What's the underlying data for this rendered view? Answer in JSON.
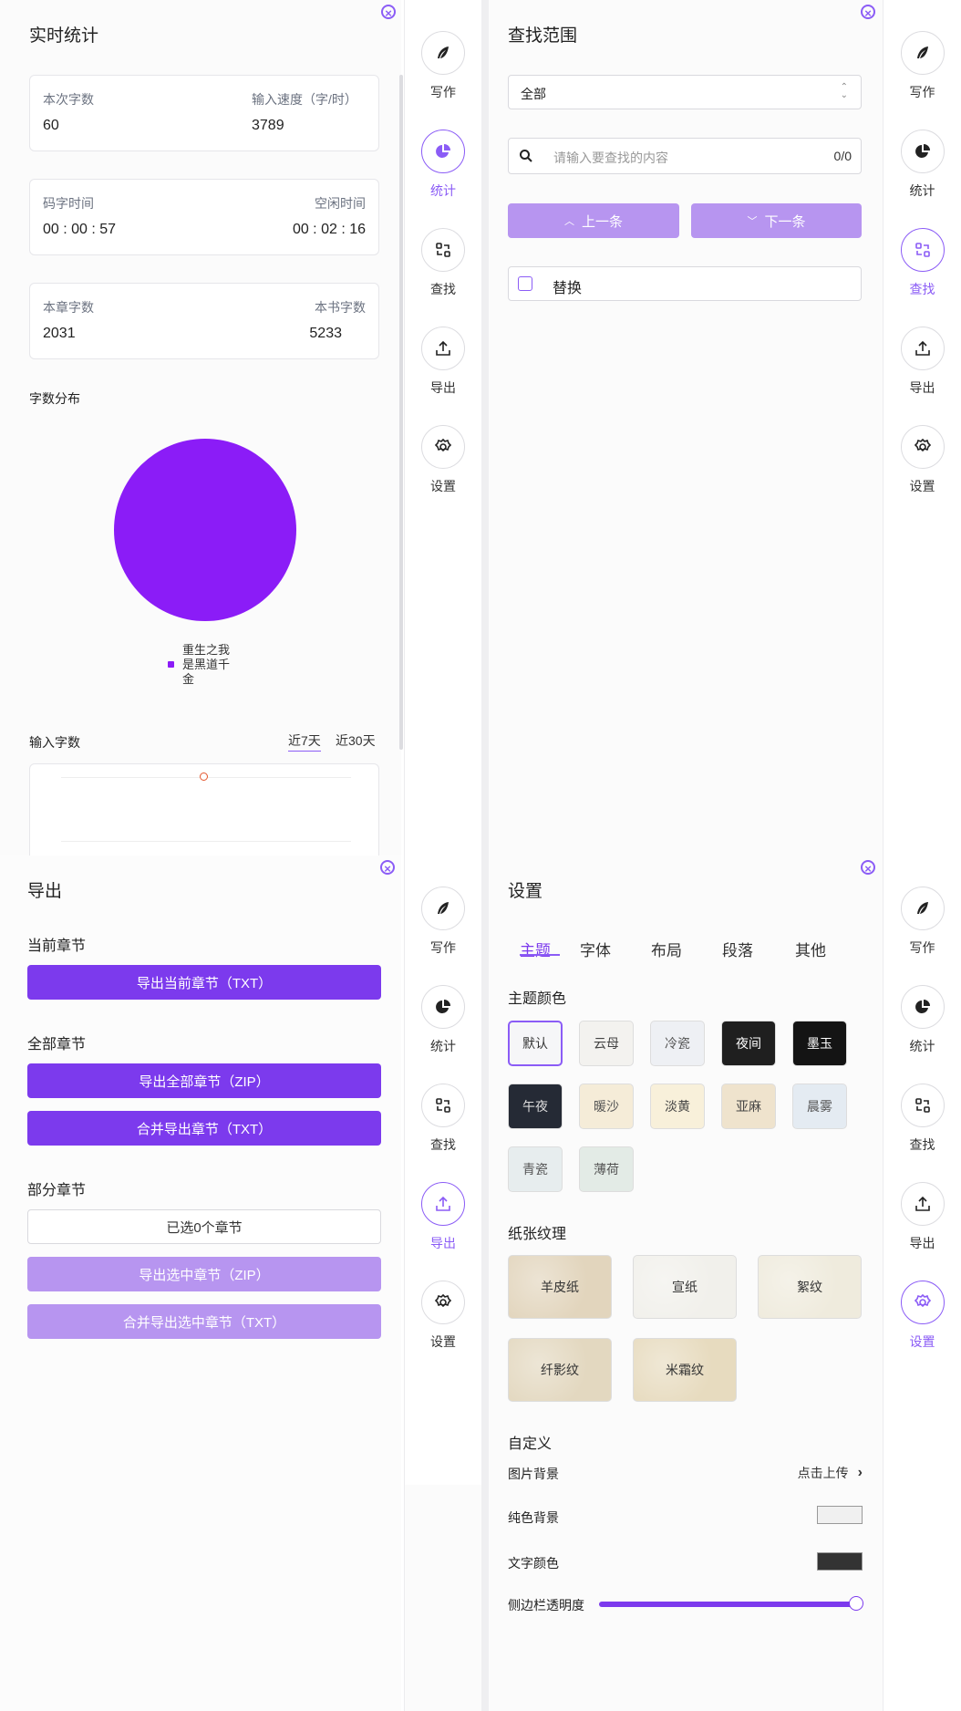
{
  "close_symbol": "×",
  "nav": {
    "items": [
      {
        "key": "write",
        "label": "写作",
        "icon": "feather-icon"
      },
      {
        "key": "stats",
        "label": "统计",
        "icon": "pie-chart-icon"
      },
      {
        "key": "find",
        "label": "查找",
        "icon": "swap-icon"
      },
      {
        "key": "export",
        "label": "导出",
        "icon": "upload-icon"
      },
      {
        "key": "settings",
        "label": "设置",
        "icon": "gear-icon"
      }
    ],
    "accent_color": "#8b5cf6"
  },
  "stats": {
    "title": "实时统计",
    "cards": [
      {
        "left_label": "本次字数",
        "left_value": "60",
        "right_label": "输入速度（字/时）",
        "right_value": "3789"
      },
      {
        "left_label": "码字时间",
        "left_value": "00 : 00 : 57",
        "right_label": "空闲时间",
        "right_value": "00 : 02 : 16"
      },
      {
        "left_label": "本章字数",
        "left_value": "2031",
        "right_label": "本书字数",
        "right_value": "5233"
      }
    ],
    "distribution_title": "字数分布",
    "input_title": "输入字数",
    "range_tabs": [
      "近7天",
      "近30天"
    ],
    "active_range": "近7天"
  },
  "chart_data": {
    "type": "pie",
    "categories": [
      "重生之我是黑道千金"
    ],
    "values": [
      100
    ],
    "colors": [
      "#8b1cf7"
    ],
    "legend": [
      "重生之我",
      "是黑道千",
      "金"
    ]
  },
  "find": {
    "title": "查找范围",
    "scope_value": "全部",
    "search_placeholder": "请输入要查找的内容",
    "count": "0/0",
    "prev_label": "上一条",
    "next_label": "下一条",
    "replace_label": "替换"
  },
  "export": {
    "title": "导出",
    "current_section": "当前章节",
    "current_btn": "导出当前章节（TXT）",
    "all_section": "全部章节",
    "all_zip_btn": "导出全部章节（ZIP）",
    "all_merge_btn": "合并导出章节（TXT）",
    "part_section": "部分章节",
    "selected_text": "已选0个章节",
    "sel_zip_btn": "导出选中章节（ZIP）",
    "sel_merge_btn": "合并导出选中章节（TXT）"
  },
  "settings": {
    "title": "设置",
    "tabs": [
      "主题",
      "字体",
      "布局",
      "段落",
      "其他"
    ],
    "active_tab": "主题",
    "theme_title": "主题颜色",
    "themes": [
      {
        "label": "默认",
        "bg": "#f6f6f8",
        "fg": "#333333"
      },
      {
        "label": "云母",
        "bg": "#f3f2ef",
        "fg": "#444444"
      },
      {
        "label": "冷瓷",
        "bg": "#eef0f4",
        "fg": "#555555"
      },
      {
        "label": "夜间",
        "bg": "#1f1f1f",
        "fg": "#ffffff"
      },
      {
        "label": "墨玉",
        "bg": "#141414",
        "fg": "#ffffff"
      },
      {
        "label": "午夜",
        "bg": "#252a35",
        "fg": "#dddddd"
      },
      {
        "label": "暖沙",
        "bg": "#f5ecd8",
        "fg": "#555555"
      },
      {
        "label": "淡黄",
        "bg": "#f8f0da",
        "fg": "#444444"
      },
      {
        "label": "亚麻",
        "bg": "#efe3cd",
        "fg": "#444444"
      },
      {
        "label": "晨雾",
        "bg": "#e4ebf2",
        "fg": "#555555"
      },
      {
        "label": "青瓷",
        "bg": "#e7edee",
        "fg": "#555555"
      },
      {
        "label": "薄荷",
        "bg": "#e3ebe6",
        "fg": "#555555"
      }
    ],
    "texture_title": "纸张纹理",
    "textures": [
      {
        "label": "羊皮纸",
        "bg": "#e2d5bd"
      },
      {
        "label": "宣纸",
        "bg": "#f1f0eb"
      },
      {
        "label": "絮纹",
        "bg": "#efebdd"
      },
      {
        "label": "纤影纹",
        "bg": "#e3d8c0"
      },
      {
        "label": "米霜纹",
        "bg": "#e7dbbf"
      }
    ],
    "custom_title": "自定义",
    "image_bg_label": "图片背景",
    "image_bg_action": "点击上传",
    "solid_bg_label": "纯色背景",
    "solid_bg_color": "#f0f0f0",
    "text_color_label": "文字颜色",
    "text_color": "#333333",
    "sidebar_opacity_label": "侧边栏透明度",
    "sidebar_opacity": 1.0
  }
}
